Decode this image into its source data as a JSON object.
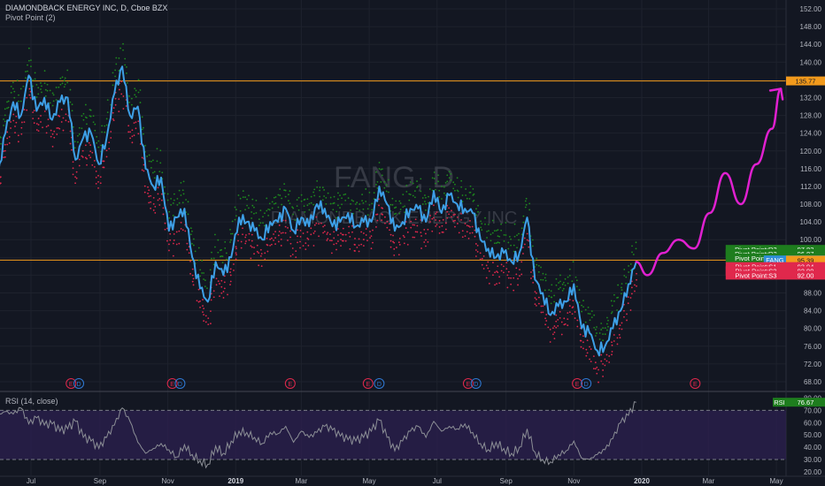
{
  "header": {
    "symbol_title": "DIAMONDBACK ENERGY INC, D, Cboe BZX",
    "indicator_label": "Pivot Point (2)",
    "watermark_symbol": "FANG, D",
    "watermark_name": "DIAMONDBACK ENERGY INC"
  },
  "rsi_pane": {
    "label": "RSI (14, close)",
    "badge_label": "RSI",
    "badge_value": "76.67"
  },
  "colors": {
    "background": "#131722",
    "price_line": "#3d9fe6",
    "resistance_dots": "#1e8a1e",
    "support_dots": "#e0284c",
    "horizontal_lines": "#f29a1c",
    "projection": "#e020d0",
    "rsi_line": "#8c8f96",
    "rsi_band": "#2a1f4d",
    "event_marker": "#e0284c",
    "dividend_marker": "#2f7ad6"
  },
  "chart_data": [
    {
      "type": "line",
      "title": "DIAMONDBACK ENERGY INC, D, Cboe BZX",
      "x_ticks": [
        "Jul",
        "Sep",
        "Nov",
        "2019",
        "Mar",
        "May",
        "Jul",
        "Sep",
        "Nov",
        "2020",
        "Mar",
        "May"
      ],
      "bold_ticks": [
        "2019",
        "2020"
      ],
      "ylim": [
        66,
        154
      ],
      "y_ticks": [
        68.0,
        72.0,
        76.0,
        80.0,
        84.0,
        88.0,
        92.0,
        96.0,
        100.0,
        104.0,
        108.0,
        112.0,
        116.0,
        120.0,
        124.0,
        128.0,
        132.0,
        136.0,
        140.0,
        144.0,
        148.0,
        152.0
      ],
      "series": [
        {
          "name": "FANG",
          "x": [
            "2018-06-01",
            "2018-06-08",
            "2018-06-15",
            "2018-06-22",
            "2018-06-29",
            "2018-07-06",
            "2018-07-13",
            "2018-07-20",
            "2018-07-27",
            "2018-08-03",
            "2018-08-10",
            "2018-08-17",
            "2018-08-24",
            "2018-08-31",
            "2018-09-07",
            "2018-09-14",
            "2018-09-21",
            "2018-09-28",
            "2018-10-05",
            "2018-10-12",
            "2018-10-19",
            "2018-10-26",
            "2018-11-02",
            "2018-11-09",
            "2018-11-16",
            "2018-11-23",
            "2018-11-30",
            "2018-12-07",
            "2018-12-14",
            "2018-12-21",
            "2018-12-28",
            "2019-01-04",
            "2019-01-11",
            "2019-01-18",
            "2019-01-25",
            "2019-02-01",
            "2019-02-08",
            "2019-02-15",
            "2019-02-22",
            "2019-03-01",
            "2019-03-08",
            "2019-03-15",
            "2019-03-22",
            "2019-03-29",
            "2019-04-05",
            "2019-04-12",
            "2019-04-19",
            "2019-04-26",
            "2019-05-03",
            "2019-05-10",
            "2019-05-17",
            "2019-05-24",
            "2019-05-31",
            "2019-06-07",
            "2019-06-14",
            "2019-06-21",
            "2019-06-28",
            "2019-07-05",
            "2019-07-12",
            "2019-07-19",
            "2019-07-26",
            "2019-08-02",
            "2019-08-09",
            "2019-08-16",
            "2019-08-23",
            "2019-08-30",
            "2019-09-06",
            "2019-09-13",
            "2019-09-20",
            "2019-09-27",
            "2019-10-04",
            "2019-10-11",
            "2019-10-18",
            "2019-10-25",
            "2019-11-01",
            "2019-11-08",
            "2019-11-15",
            "2019-11-22",
            "2019-11-29",
            "2019-12-06",
            "2019-12-13",
            "2019-12-20",
            "2019-12-27"
          ],
          "y": [
            114,
            124,
            131,
            128,
            137,
            129,
            132,
            127,
            131,
            132,
            118,
            123,
            124,
            117,
            123,
            133,
            139,
            128,
            130,
            116,
            112,
            114,
            102,
            105,
            107,
            96,
            89,
            86,
            95,
            92,
            96,
            105,
            104,
            102,
            100,
            104,
            104,
            107,
            102,
            105,
            103,
            108,
            107,
            103,
            104,
            106,
            103,
            104,
            104,
            112,
            108,
            102,
            104,
            107,
            107,
            104,
            111,
            106,
            110,
            108,
            107,
            106,
            100,
            98,
            96,
            97,
            95,
            97,
            105,
            91,
            88,
            83,
            85,
            86,
            90,
            80,
            79,
            75,
            76,
            80,
            84,
            90,
            95
          ]
        },
        {
          "name": "Pivot Point:R3",
          "values": [
            97.82
          ]
        },
        {
          "name": "Pivot Point:R2",
          "values": [
            96.87
          ]
        },
        {
          "name": "Pivot Point:R1",
          "values": [
            95.88
          ]
        },
        {
          "name": "Pivot Point:S1",
          "values": [
            93.94
          ]
        },
        {
          "name": "Pivot Point:S2",
          "values": [
            92.99
          ]
        },
        {
          "name": "Pivot Point:S3",
          "values": [
            92.0
          ]
        }
      ],
      "horizontal_lines": [
        135.77,
        95.39
      ],
      "price_tags": [
        {
          "label": "",
          "value": "135.77",
          "price": 135.77,
          "color": "#f29a1c",
          "text_color": "#131722"
        },
        {
          "label": "Pivot Point:R3",
          "value": "97.82",
          "price": 97.82,
          "color": "#1e7d1e",
          "text_color": "#ffffff"
        },
        {
          "label": "Pivot Point:R2",
          "value": "96.87",
          "price": 96.87,
          "color": "#1e7d1e",
          "text_color": "#ffffff"
        },
        {
          "label": "Pivot Point:R1",
          "value": "95.88",
          "price": 95.88,
          "color": "#1e7d1e",
          "text_color": "#ffffff"
        },
        {
          "label": "FANG",
          "value": "95.44",
          "price": 95.44,
          "color": "#2f8fd8",
          "text_color": "#ffffff"
        },
        {
          "label": "",
          "value": "95.39",
          "price": 95.39,
          "color": "#f29a1c",
          "text_color": "#131722"
        },
        {
          "label": "Pivot Point:S1",
          "value": "93.94",
          "price": 93.94,
          "color": "#e0284c",
          "text_color": "#ffffff"
        },
        {
          "label": "Pivot Point:S2",
          "value": "92.99",
          "price": 92.99,
          "color": "#e0284c",
          "text_color": "#ffffff"
        },
        {
          "label": "Pivot Point:S3",
          "value": "92.00",
          "price": 92.0,
          "color": "#e0284c",
          "text_color": "#ffffff"
        }
      ],
      "projection": {
        "x": [
          "2019-12-27",
          "2020-01-06",
          "2020-01-20",
          "2020-02-03",
          "2020-02-17",
          "2020-03-02",
          "2020-03-16",
          "2020-03-30",
          "2020-04-13",
          "2020-04-27",
          "2020-05-05"
        ],
        "y": [
          95,
          92,
          97,
          100,
          98,
          106,
          115,
          108,
          117,
          125,
          134
        ]
      },
      "events": [
        {
          "date": "2018-08-06",
          "label": "E"
        },
        {
          "date": "2018-08-13",
          "label": "D"
        },
        {
          "date": "2018-11-05",
          "label": "E"
        },
        {
          "date": "2018-11-12",
          "label": "D"
        },
        {
          "date": "2019-02-19",
          "label": "E"
        },
        {
          "date": "2019-04-30",
          "label": "E"
        },
        {
          "date": "2019-05-10",
          "label": "D"
        },
        {
          "date": "2019-07-29",
          "label": "E"
        },
        {
          "date": "2019-08-05",
          "label": "D"
        },
        {
          "date": "2019-11-04",
          "label": "E"
        },
        {
          "date": "2019-11-12",
          "label": "D"
        },
        {
          "date": "2020-02-18",
          "label": "E"
        }
      ]
    },
    {
      "type": "line",
      "title": "RSI (14, close)",
      "ylim": [
        17,
        84
      ],
      "y_ticks": [
        20.0,
        30.0,
        40.0,
        50.0,
        60.0,
        70.0,
        80.0
      ],
      "band": [
        30,
        70
      ],
      "series": [
        {
          "name": "RSI",
          "y": [
            66,
            69,
            67,
            72,
            59,
            64,
            58,
            59,
            53,
            55,
            61,
            48,
            45,
            39,
            48,
            58,
            72,
            61,
            44,
            35,
            39,
            43,
            38,
            32,
            42,
            34,
            29,
            26,
            41,
            35,
            45,
            53,
            52,
            48,
            43,
            52,
            51,
            57,
            44,
            53,
            48,
            52,
            57,
            54,
            49,
            46,
            45,
            48,
            53,
            62,
            48,
            37,
            45,
            53,
            57,
            48,
            61,
            53,
            57,
            55,
            59,
            52,
            43,
            38,
            44,
            39,
            35,
            40,
            55,
            36,
            30,
            28,
            34,
            37,
            45,
            31,
            30,
            34,
            38,
            47,
            60,
            66,
            76.67
          ]
        }
      ]
    }
  ]
}
